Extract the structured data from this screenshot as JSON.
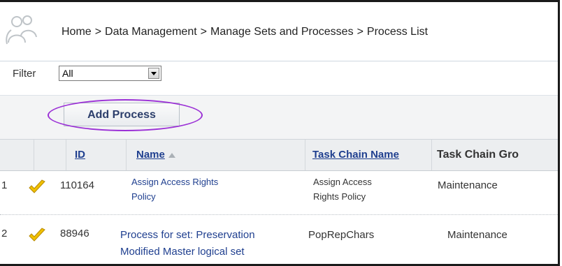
{
  "breadcrumb": {
    "items": [
      "Home",
      "Data Management",
      "Manage Sets and Processes",
      "Process List"
    ],
    "separator": ">"
  },
  "filter": {
    "label": "Filter",
    "selected": "All"
  },
  "actions": {
    "add_process_label": "Add Process"
  },
  "table": {
    "columns": {
      "id": "ID",
      "name": "Name",
      "task_chain_name": "Task Chain Name",
      "task_chain_group": "Task Chain Gro"
    },
    "rows": [
      {
        "index": "1",
        "id": "110164",
        "name_line1": "Assign Access Rights",
        "name_line2": "Policy",
        "task_chain_line1": "Assign Access",
        "task_chain_line2": "Rights Policy",
        "group": "Maintenance"
      },
      {
        "index": "2",
        "id": "88946",
        "name_line1": "Process for set: Preservation",
        "name_line2": "Modified Master logical set",
        "task_chain_line1": "PopRepChars",
        "task_chain_line2": "",
        "group": "Maintenance"
      }
    ]
  },
  "colors": {
    "link": "#1f3f8f",
    "highlight": "#9b30d6",
    "check": "#f0c000"
  },
  "icons": {
    "breadcrumb": "users-group-icon",
    "status": "checkmark-icon",
    "sort": "sort-ascending-icon"
  }
}
